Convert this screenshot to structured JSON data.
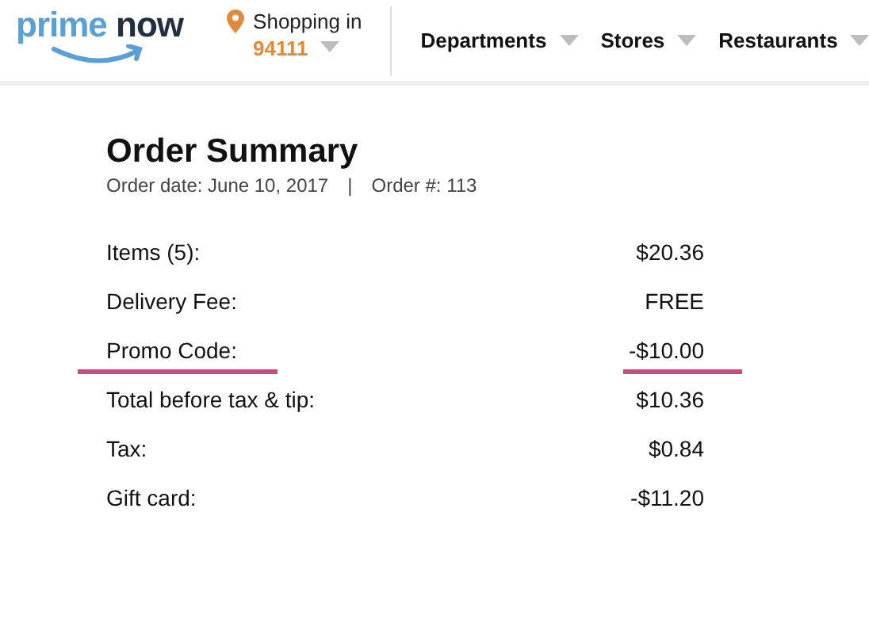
{
  "header": {
    "logo": {
      "text_1": "prime",
      "text_2": "now"
    },
    "location": {
      "label": "Shopping in",
      "zip": "94111"
    },
    "nav": [
      {
        "label": "Departments"
      },
      {
        "label": "Stores"
      },
      {
        "label": "Restaurants"
      }
    ]
  },
  "summary": {
    "title": "Order Summary",
    "order_date": "Order date: June 10, 2017",
    "separator": "|",
    "order_number": "Order #: 113",
    "rows": [
      {
        "label": "Items (5):",
        "amount": "$20.36",
        "highlighted": false
      },
      {
        "label": "Delivery Fee:",
        "amount": "FREE",
        "highlighted": false
      },
      {
        "label": "Promo Code:",
        "amount": "-$10.00",
        "highlighted": true
      },
      {
        "label": "Total before tax & tip:",
        "amount": "$10.36",
        "highlighted": false
      },
      {
        "label": "Tax:",
        "amount": "$0.84",
        "highlighted": false
      },
      {
        "label": "Gift card:",
        "amount": "-$11.20",
        "highlighted": false
      }
    ]
  }
}
